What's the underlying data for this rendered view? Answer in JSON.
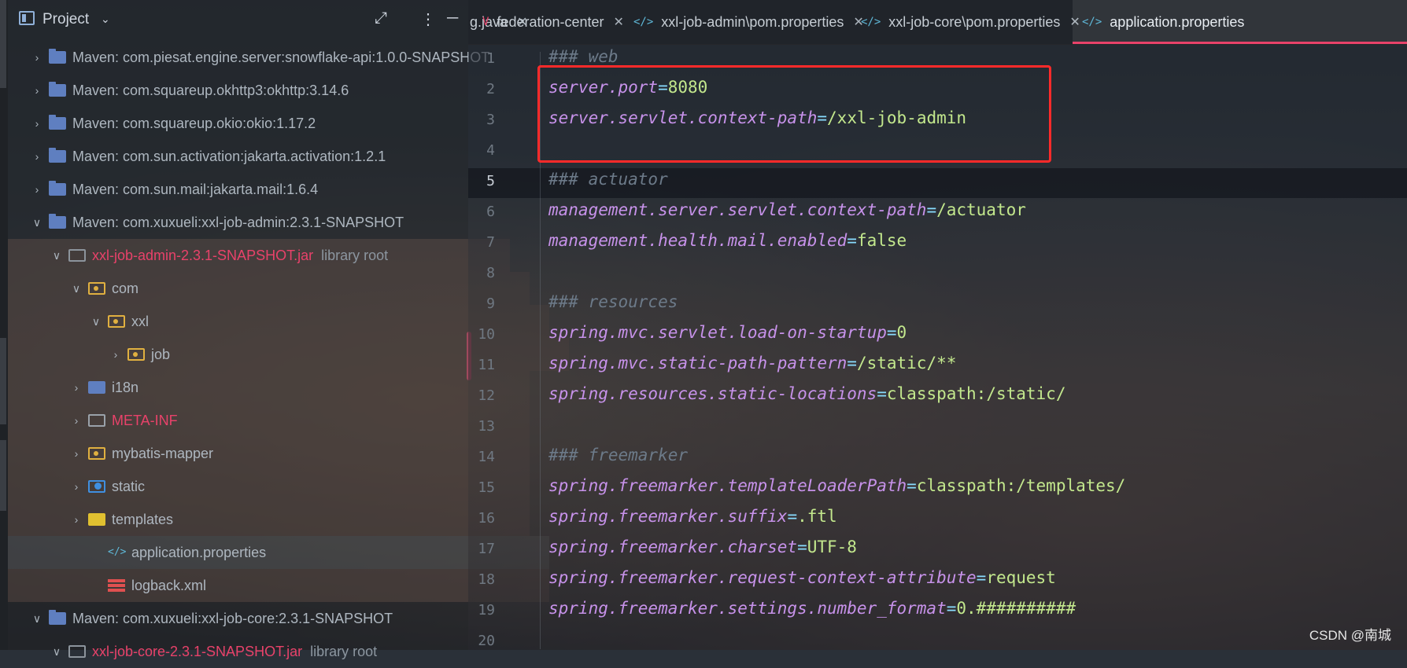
{
  "project_panel": {
    "title": "Project",
    "tree": [
      {
        "label": "Maven: com.piesat.engine.server:snowflake-api:1.0.0-SNAPSHOT",
        "icon": "maven-library-icon",
        "expanded": false
      },
      {
        "label": "Maven: com.squareup.okhttp3:okhttp:3.14.6",
        "icon": "maven-library-icon",
        "expanded": false
      },
      {
        "label": "Maven: com.squareup.okio:okio:1.17.2",
        "icon": "maven-library-icon",
        "expanded": false
      },
      {
        "label": "Maven: com.sun.activation:jakarta.activation:1.2.1",
        "icon": "maven-library-icon",
        "expanded": false
      },
      {
        "label": "Maven: com.sun.mail:jakarta.mail:1.6.4",
        "icon": "maven-library-icon",
        "expanded": false
      },
      {
        "label": "Maven: com.xuxueli:xxl-job-admin:2.3.1-SNAPSHOT",
        "icon": "maven-library-icon",
        "expanded": true
      },
      {
        "label": "xxl-job-admin-2.3.1-SNAPSHOT.jar",
        "suffix": "library root",
        "icon": "jar-icon",
        "expanded": true
      },
      {
        "label": "com",
        "icon": "package-icon",
        "expanded": true
      },
      {
        "label": "xxl",
        "icon": "package-icon",
        "expanded": true
      },
      {
        "label": "job",
        "icon": "package-icon",
        "expanded": false
      },
      {
        "label": "i18n",
        "icon": "resource-bundle-icon",
        "expanded": false
      },
      {
        "label": "META-INF",
        "icon": "folder-icon",
        "expanded": false
      },
      {
        "label": "mybatis-mapper",
        "icon": "package-icon",
        "expanded": false
      },
      {
        "label": "static",
        "icon": "web-folder-icon",
        "expanded": false
      },
      {
        "label": "templates",
        "icon": "templates-folder-icon",
        "expanded": false
      },
      {
        "label": "application.properties",
        "icon": "properties-file-icon"
      },
      {
        "label": "logback.xml",
        "icon": "xml-file-icon"
      },
      {
        "label": "Maven: com.xuxueli:xxl-job-core:2.3.1-SNAPSHOT",
        "icon": "maven-library-icon",
        "expanded": true
      },
      {
        "label": "xxl-job-core-2.3.1-SNAPSHOT.jar",
        "suffix": "library root",
        "icon": "jar-icon",
        "expanded": true
      }
    ]
  },
  "tabs": [
    {
      "label": "g.java",
      "icon": ""
    },
    {
      "label": "federation-center",
      "icon": "V"
    },
    {
      "label": "xxl-job-admin\\pom.properties",
      "icon": "</>"
    },
    {
      "label": "xxl-job-core\\pom.properties",
      "icon": "</>"
    },
    {
      "label": "application.properties",
      "icon": "</>"
    }
  ],
  "editor": {
    "current_line": 5,
    "lines": [
      {
        "n": "1",
        "parts": [
          [
            "cm",
            "### web"
          ]
        ]
      },
      {
        "n": "2",
        "parts": [
          [
            "k",
            "server.port"
          ],
          [
            "eq",
            "="
          ],
          [
            "v",
            "8080"
          ]
        ]
      },
      {
        "n": "3",
        "parts": [
          [
            "k",
            "server.servlet.context-path"
          ],
          [
            "eq",
            "="
          ],
          [
            "v",
            "/xxl-job-admin"
          ]
        ]
      },
      {
        "n": "4",
        "parts": []
      },
      {
        "n": "5",
        "parts": [
          [
            "cm",
            "### actuator"
          ]
        ]
      },
      {
        "n": "6",
        "parts": [
          [
            "k",
            "management.server.servlet.context-path"
          ],
          [
            "eq",
            "="
          ],
          [
            "v",
            "/actuator"
          ]
        ]
      },
      {
        "n": "7",
        "parts": [
          [
            "k",
            "management.health.mail.enabled"
          ],
          [
            "eq",
            "="
          ],
          [
            "v",
            "false"
          ]
        ]
      },
      {
        "n": "8",
        "parts": []
      },
      {
        "n": "9",
        "parts": [
          [
            "cm",
            "### resources"
          ]
        ]
      },
      {
        "n": "10",
        "parts": [
          [
            "k",
            "spring.mvc.servlet.load-on-startup"
          ],
          [
            "eq",
            "="
          ],
          [
            "v",
            "0"
          ]
        ]
      },
      {
        "n": "11",
        "parts": [
          [
            "k",
            "spring.mvc.static-path-pattern"
          ],
          [
            "eq",
            "="
          ],
          [
            "v",
            "/static/**"
          ]
        ]
      },
      {
        "n": "12",
        "parts": [
          [
            "k",
            "spring.resources.static-locations"
          ],
          [
            "eq",
            "="
          ],
          [
            "v",
            "classpath:/static/"
          ]
        ]
      },
      {
        "n": "13",
        "parts": []
      },
      {
        "n": "14",
        "parts": [
          [
            "cm",
            "### freemarker"
          ]
        ]
      },
      {
        "n": "15",
        "parts": [
          [
            "k",
            "spring.freemarker.templateLoaderPath"
          ],
          [
            "eq",
            "="
          ],
          [
            "v",
            "classpath:/templates/"
          ]
        ]
      },
      {
        "n": "16",
        "parts": [
          [
            "k",
            "spring.freemarker.suffix"
          ],
          [
            "eq",
            "="
          ],
          [
            "v",
            ".ftl"
          ]
        ]
      },
      {
        "n": "17",
        "parts": [
          [
            "k",
            "spring.freemarker.charset"
          ],
          [
            "eq",
            "="
          ],
          [
            "v",
            "UTF-8"
          ]
        ]
      },
      {
        "n": "18",
        "parts": [
          [
            "k",
            "spring.freemarker.request-context-attribute"
          ],
          [
            "eq",
            "="
          ],
          [
            "v",
            "request"
          ]
        ]
      },
      {
        "n": "19",
        "parts": [
          [
            "k",
            "spring.freemarker.settings.number_format"
          ],
          [
            "eq",
            "="
          ],
          [
            "v",
            "0.##########"
          ]
        ]
      },
      {
        "n": "20",
        "parts": []
      }
    ]
  },
  "watermark": "CSDN @南城⁣",
  "colors": {
    "highlight_box": "#ff2a2a",
    "accent": "#e8426a"
  }
}
